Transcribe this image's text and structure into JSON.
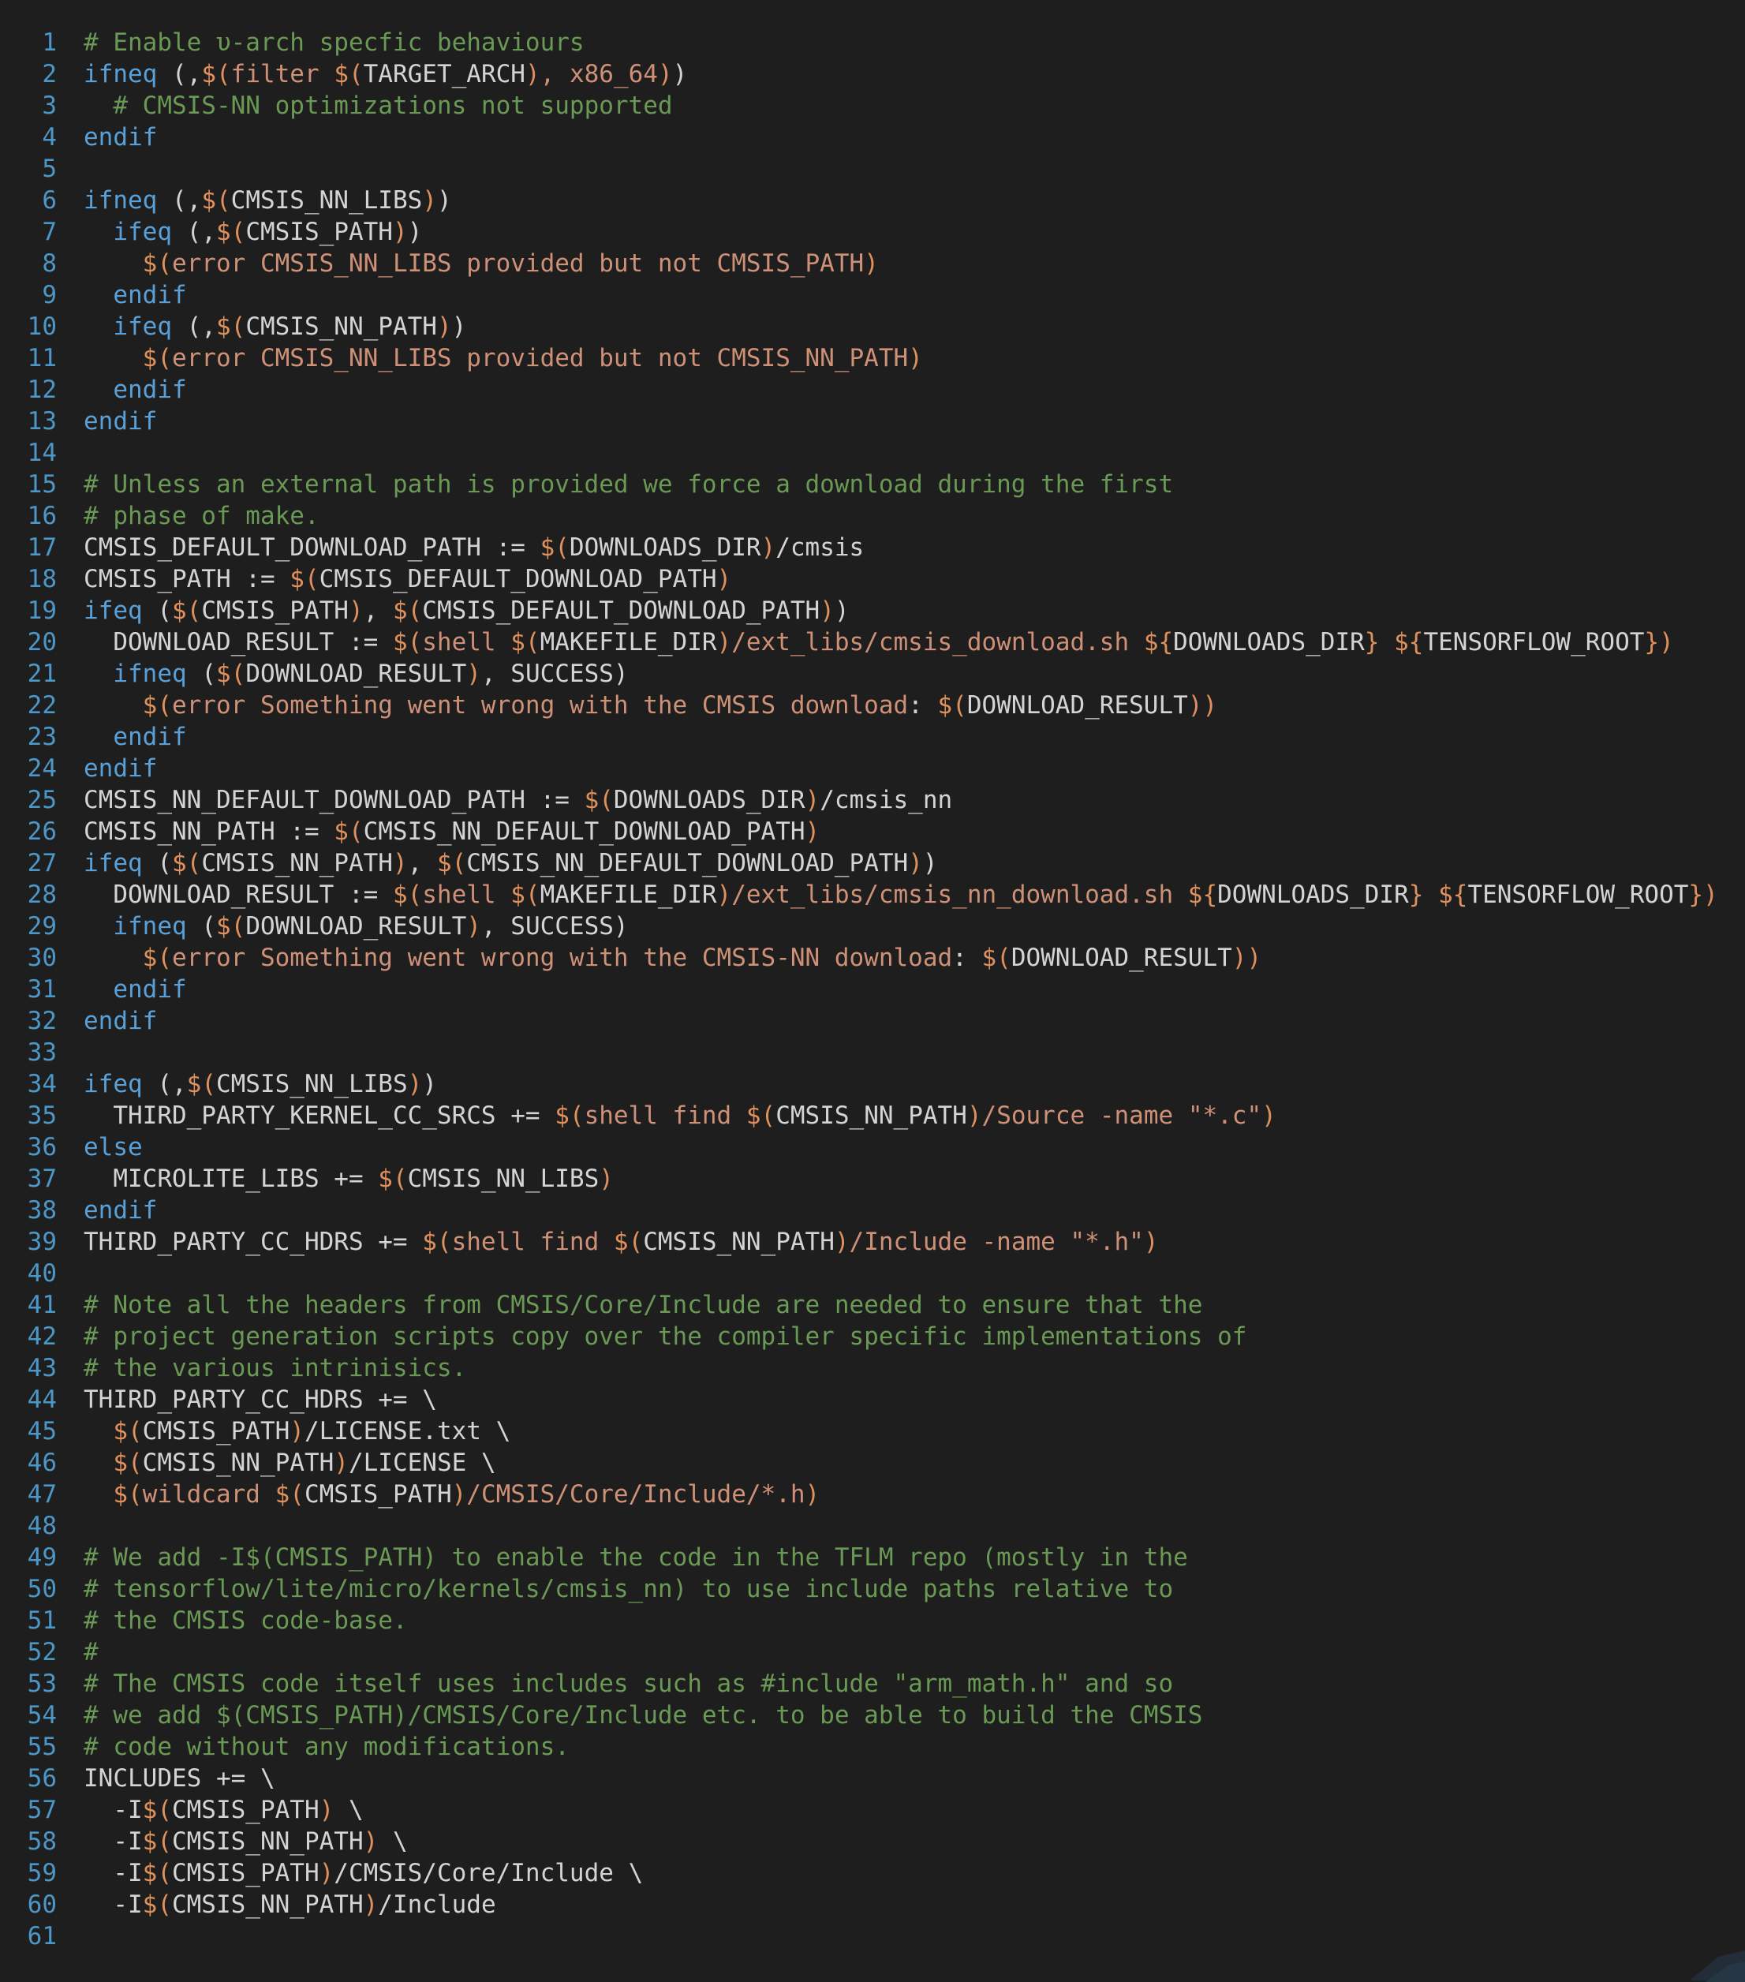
{
  "editor": {
    "colors": {
      "background": "#1e1e1e",
      "line_number": "#4b97c8",
      "keyword": "#5aa0d8",
      "comment": "#6a9955",
      "string": "#ce9178",
      "dollar": "#e0905c",
      "text": "#d4d4d4"
    },
    "lines": [
      {
        "n": "1",
        "t": [
          [
            "c",
            "# Enable υ-arch specfic behaviours"
          ]
        ]
      },
      {
        "n": "2",
        "t": [
          [
            "k",
            "ifneq"
          ],
          [
            "p",
            " (,"
          ],
          [
            "d",
            "$("
          ],
          [
            "s",
            "filter "
          ],
          [
            "d",
            "$("
          ],
          [
            "v",
            "TARGET_ARCH"
          ],
          [
            "d",
            ")"
          ],
          [
            "s",
            ", x86_64"
          ],
          [
            "d",
            ")"
          ],
          [
            "p",
            ")"
          ]
        ]
      },
      {
        "n": "3",
        "t": [
          [
            "p",
            "  "
          ],
          [
            "c",
            "# CMSIS-NN optimizations not supported"
          ]
        ]
      },
      {
        "n": "4",
        "t": [
          [
            "k",
            "endif"
          ]
        ]
      },
      {
        "n": "5",
        "t": []
      },
      {
        "n": "6",
        "t": [
          [
            "k",
            "ifneq"
          ],
          [
            "p",
            " (,"
          ],
          [
            "d",
            "$("
          ],
          [
            "v",
            "CMSIS_NN_LIBS"
          ],
          [
            "d",
            ")"
          ],
          [
            "p",
            ")"
          ]
        ]
      },
      {
        "n": "7",
        "t": [
          [
            "p",
            "  "
          ],
          [
            "k",
            "ifeq"
          ],
          [
            "p",
            " (,"
          ],
          [
            "d",
            "$("
          ],
          [
            "v",
            "CMSIS_PATH"
          ],
          [
            "d",
            ")"
          ],
          [
            "p",
            ")"
          ]
        ]
      },
      {
        "n": "8",
        "t": [
          [
            "p",
            "    "
          ],
          [
            "d",
            "$("
          ],
          [
            "s",
            "error CMSIS_NN_LIBS provided but not CMSIS_PATH"
          ],
          [
            "d",
            ")"
          ]
        ]
      },
      {
        "n": "9",
        "t": [
          [
            "p",
            "  "
          ],
          [
            "k",
            "endif"
          ]
        ]
      },
      {
        "n": "10",
        "t": [
          [
            "p",
            "  "
          ],
          [
            "k",
            "ifeq"
          ],
          [
            "p",
            " (,"
          ],
          [
            "d",
            "$("
          ],
          [
            "v",
            "CMSIS_NN_PATH"
          ],
          [
            "d",
            ")"
          ],
          [
            "p",
            ")"
          ]
        ]
      },
      {
        "n": "11",
        "t": [
          [
            "p",
            "    "
          ],
          [
            "d",
            "$("
          ],
          [
            "s",
            "error CMSIS_NN_LIBS provided but not CMSIS_NN_PATH"
          ],
          [
            "d",
            ")"
          ]
        ]
      },
      {
        "n": "12",
        "t": [
          [
            "p",
            "  "
          ],
          [
            "k",
            "endif"
          ]
        ]
      },
      {
        "n": "13",
        "t": [
          [
            "k",
            "endif"
          ]
        ]
      },
      {
        "n": "14",
        "t": []
      },
      {
        "n": "15",
        "t": [
          [
            "c",
            "# Unless an external path is provided we force a download during the first"
          ]
        ]
      },
      {
        "n": "16",
        "t": [
          [
            "c",
            "# phase of make."
          ]
        ]
      },
      {
        "n": "17",
        "t": [
          [
            "v",
            "CMSIS_DEFAULT_DOWNLOAD_PATH := "
          ],
          [
            "d",
            "$("
          ],
          [
            "v",
            "DOWNLOADS_DIR"
          ],
          [
            "d",
            ")"
          ],
          [
            "v",
            "/cmsis"
          ]
        ]
      },
      {
        "n": "18",
        "t": [
          [
            "v",
            "CMSIS_PATH := "
          ],
          [
            "d",
            "$("
          ],
          [
            "v",
            "CMSIS_DEFAULT_DOWNLOAD_PATH"
          ],
          [
            "d",
            ")"
          ]
        ]
      },
      {
        "n": "19",
        "t": [
          [
            "k",
            "ifeq"
          ],
          [
            "p",
            " ("
          ],
          [
            "d",
            "$("
          ],
          [
            "v",
            "CMSIS_PATH"
          ],
          [
            "d",
            ")"
          ],
          [
            "p",
            ", "
          ],
          [
            "d",
            "$("
          ],
          [
            "v",
            "CMSIS_DEFAULT_DOWNLOAD_PATH"
          ],
          [
            "d",
            ")"
          ],
          [
            "p",
            ")"
          ]
        ]
      },
      {
        "n": "20",
        "t": [
          [
            "p",
            "  "
          ],
          [
            "v",
            "DOWNLOAD_RESULT := "
          ],
          [
            "d",
            "$("
          ],
          [
            "s",
            "shell "
          ],
          [
            "d",
            "$("
          ],
          [
            "v",
            "MAKEFILE_DIR"
          ],
          [
            "d",
            ")"
          ],
          [
            "s",
            "/ext_libs/cmsis_download.sh "
          ],
          [
            "d",
            "${"
          ],
          [
            "v",
            "DOWNLOADS_DIR"
          ],
          [
            "d",
            "}"
          ],
          [
            "s",
            " "
          ],
          [
            "d",
            "${"
          ],
          [
            "v",
            "TENSORFLOW_ROOT"
          ],
          [
            "d",
            "}"
          ],
          [
            "d",
            ")"
          ]
        ]
      },
      {
        "n": "21",
        "t": [
          [
            "p",
            "  "
          ],
          [
            "k",
            "ifneq"
          ],
          [
            "p",
            " ("
          ],
          [
            "d",
            "$("
          ],
          [
            "v",
            "DOWNLOAD_RESULT"
          ],
          [
            "d",
            ")"
          ],
          [
            "p",
            ", SUCCESS)"
          ]
        ]
      },
      {
        "n": "22",
        "t": [
          [
            "p",
            "    "
          ],
          [
            "d",
            "$("
          ],
          [
            "s",
            "error Something went wrong with the CMSIS download"
          ],
          [
            "p",
            ": "
          ],
          [
            "d",
            "$("
          ],
          [
            "v",
            "DOWNLOAD_RESULT"
          ],
          [
            "d",
            ")"
          ],
          [
            "d",
            ")"
          ]
        ]
      },
      {
        "n": "23",
        "t": [
          [
            "p",
            "  "
          ],
          [
            "k",
            "endif"
          ]
        ]
      },
      {
        "n": "24",
        "t": [
          [
            "k",
            "endif"
          ]
        ]
      },
      {
        "n": "25",
        "t": [
          [
            "v",
            "CMSIS_NN_DEFAULT_DOWNLOAD_PATH := "
          ],
          [
            "d",
            "$("
          ],
          [
            "v",
            "DOWNLOADS_DIR"
          ],
          [
            "d",
            ")"
          ],
          [
            "v",
            "/cmsis_nn"
          ]
        ]
      },
      {
        "n": "26",
        "t": [
          [
            "v",
            "CMSIS_NN_PATH := "
          ],
          [
            "d",
            "$("
          ],
          [
            "v",
            "CMSIS_NN_DEFAULT_DOWNLOAD_PATH"
          ],
          [
            "d",
            ")"
          ]
        ]
      },
      {
        "n": "27",
        "t": [
          [
            "k",
            "ifeq"
          ],
          [
            "p",
            " ("
          ],
          [
            "d",
            "$("
          ],
          [
            "v",
            "CMSIS_NN_PATH"
          ],
          [
            "d",
            ")"
          ],
          [
            "p",
            ", "
          ],
          [
            "d",
            "$("
          ],
          [
            "v",
            "CMSIS_NN_DEFAULT_DOWNLOAD_PATH"
          ],
          [
            "d",
            ")"
          ],
          [
            "p",
            ")"
          ]
        ]
      },
      {
        "n": "28",
        "t": [
          [
            "p",
            "  "
          ],
          [
            "v",
            "DOWNLOAD_RESULT := "
          ],
          [
            "d",
            "$("
          ],
          [
            "s",
            "shell "
          ],
          [
            "d",
            "$("
          ],
          [
            "v",
            "MAKEFILE_DIR"
          ],
          [
            "d",
            ")"
          ],
          [
            "s",
            "/ext_libs/cmsis_nn_download.sh "
          ],
          [
            "d",
            "${"
          ],
          [
            "v",
            "DOWNLOADS_DIR"
          ],
          [
            "d",
            "}"
          ],
          [
            "s",
            " "
          ],
          [
            "d",
            "${"
          ],
          [
            "v",
            "TENSORFLOW_ROOT"
          ],
          [
            "d",
            "}"
          ],
          [
            "d",
            ")"
          ]
        ]
      },
      {
        "n": "29",
        "t": [
          [
            "p",
            "  "
          ],
          [
            "k",
            "ifneq"
          ],
          [
            "p",
            " ("
          ],
          [
            "d",
            "$("
          ],
          [
            "v",
            "DOWNLOAD_RESULT"
          ],
          [
            "d",
            ")"
          ],
          [
            "p",
            ", SUCCESS)"
          ]
        ]
      },
      {
        "n": "30",
        "t": [
          [
            "p",
            "    "
          ],
          [
            "d",
            "$("
          ],
          [
            "s",
            "error Something went wrong with the CMSIS-NN download"
          ],
          [
            "p",
            ": "
          ],
          [
            "d",
            "$("
          ],
          [
            "v",
            "DOWNLOAD_RESULT"
          ],
          [
            "d",
            ")"
          ],
          [
            "d",
            ")"
          ]
        ]
      },
      {
        "n": "31",
        "t": [
          [
            "p",
            "  "
          ],
          [
            "k",
            "endif"
          ]
        ]
      },
      {
        "n": "32",
        "t": [
          [
            "k",
            "endif"
          ]
        ]
      },
      {
        "n": "33",
        "t": []
      },
      {
        "n": "34",
        "t": [
          [
            "k",
            "ifeq"
          ],
          [
            "p",
            " (,"
          ],
          [
            "d",
            "$("
          ],
          [
            "v",
            "CMSIS_NN_LIBS"
          ],
          [
            "d",
            ")"
          ],
          [
            "p",
            ")"
          ]
        ]
      },
      {
        "n": "35",
        "t": [
          [
            "p",
            "  "
          ],
          [
            "v",
            "THIRD_PARTY_KERNEL_CC_SRCS += "
          ],
          [
            "d",
            "$("
          ],
          [
            "s",
            "shell find "
          ],
          [
            "d",
            "$("
          ],
          [
            "v",
            "CMSIS_NN_PATH"
          ],
          [
            "d",
            ")"
          ],
          [
            "s",
            "/Source -name \"*.c\""
          ],
          [
            "d",
            ")"
          ]
        ]
      },
      {
        "n": "36",
        "t": [
          [
            "k",
            "else"
          ]
        ]
      },
      {
        "n": "37",
        "t": [
          [
            "p",
            "  "
          ],
          [
            "v",
            "MICROLITE_LIBS += "
          ],
          [
            "d",
            "$("
          ],
          [
            "v",
            "CMSIS_NN_LIBS"
          ],
          [
            "d",
            ")"
          ]
        ]
      },
      {
        "n": "38",
        "t": [
          [
            "k",
            "endif"
          ]
        ]
      },
      {
        "n": "39",
        "t": [
          [
            "v",
            "THIRD_PARTY_CC_HDRS += "
          ],
          [
            "d",
            "$("
          ],
          [
            "s",
            "shell find "
          ],
          [
            "d",
            "$("
          ],
          [
            "v",
            "CMSIS_NN_PATH"
          ],
          [
            "d",
            ")"
          ],
          [
            "s",
            "/Include -name \"*.h\""
          ],
          [
            "d",
            ")"
          ]
        ]
      },
      {
        "n": "40",
        "t": []
      },
      {
        "n": "41",
        "t": [
          [
            "c",
            "# Note all the headers from CMSIS/Core/Include are needed to ensure that the"
          ]
        ]
      },
      {
        "n": "42",
        "t": [
          [
            "c",
            "# project generation scripts copy over the compiler specific implementations of"
          ]
        ]
      },
      {
        "n": "43",
        "t": [
          [
            "c",
            "# the various intrinisics."
          ]
        ]
      },
      {
        "n": "44",
        "t": [
          [
            "v",
            "THIRD_PARTY_CC_HDRS += \\"
          ]
        ]
      },
      {
        "n": "45",
        "t": [
          [
            "p",
            "  "
          ],
          [
            "d",
            "$("
          ],
          [
            "v",
            "CMSIS_PATH"
          ],
          [
            "d",
            ")"
          ],
          [
            "v",
            "/LICENSE.txt \\"
          ]
        ]
      },
      {
        "n": "46",
        "t": [
          [
            "p",
            "  "
          ],
          [
            "d",
            "$("
          ],
          [
            "v",
            "CMSIS_NN_PATH"
          ],
          [
            "d",
            ")"
          ],
          [
            "v",
            "/LICENSE \\"
          ]
        ]
      },
      {
        "n": "47",
        "t": [
          [
            "p",
            "  "
          ],
          [
            "d",
            "$("
          ],
          [
            "s",
            "wildcard "
          ],
          [
            "d",
            "$("
          ],
          [
            "v",
            "CMSIS_PATH"
          ],
          [
            "d",
            ")"
          ],
          [
            "s",
            "/CMSIS/Core/Include/*.h"
          ],
          [
            "d",
            ")"
          ]
        ]
      },
      {
        "n": "48",
        "t": []
      },
      {
        "n": "49",
        "t": [
          [
            "c",
            "# We add -I$(CMSIS_PATH) to enable the code in the TFLM repo (mostly in the"
          ]
        ]
      },
      {
        "n": "50",
        "t": [
          [
            "c",
            "# tensorflow/lite/micro/kernels/cmsis_nn) to use include paths relative to"
          ]
        ]
      },
      {
        "n": "51",
        "t": [
          [
            "c",
            "# the CMSIS code-base."
          ]
        ]
      },
      {
        "n": "52",
        "t": [
          [
            "c",
            "#"
          ]
        ]
      },
      {
        "n": "53",
        "t": [
          [
            "c",
            "# The CMSIS code itself uses includes such as #include \"arm_math.h\" and so"
          ]
        ]
      },
      {
        "n": "54",
        "t": [
          [
            "c",
            "# we add $(CMSIS_PATH)/CMSIS/Core/Include etc. to be able to build the CMSIS"
          ]
        ]
      },
      {
        "n": "55",
        "t": [
          [
            "c",
            "# code without any modifications."
          ]
        ]
      },
      {
        "n": "56",
        "t": [
          [
            "v",
            "INCLUDES += \\"
          ]
        ]
      },
      {
        "n": "57",
        "t": [
          [
            "p",
            "  "
          ],
          [
            "v",
            "-I"
          ],
          [
            "d",
            "$("
          ],
          [
            "v",
            "CMSIS_PATH"
          ],
          [
            "d",
            ")"
          ],
          [
            "v",
            " \\"
          ]
        ]
      },
      {
        "n": "58",
        "t": [
          [
            "p",
            "  "
          ],
          [
            "v",
            "-I"
          ],
          [
            "d",
            "$("
          ],
          [
            "v",
            "CMSIS_NN_PATH"
          ],
          [
            "d",
            ")"
          ],
          [
            "v",
            " \\"
          ]
        ]
      },
      {
        "n": "59",
        "t": [
          [
            "p",
            "  "
          ],
          [
            "v",
            "-I"
          ],
          [
            "d",
            "$("
          ],
          [
            "v",
            "CMSIS_PATH"
          ],
          [
            "d",
            ")"
          ],
          [
            "v",
            "/CMSIS/Core/Include \\"
          ]
        ]
      },
      {
        "n": "60",
        "t": [
          [
            "p",
            "  "
          ],
          [
            "v",
            "-I"
          ],
          [
            "d",
            "$("
          ],
          [
            "v",
            "CMSIS_NN_PATH"
          ],
          [
            "d",
            ")"
          ],
          [
            "v",
            "/Include"
          ]
        ]
      },
      {
        "n": "61",
        "t": []
      }
    ]
  },
  "corner_icon": "watermark-icon"
}
